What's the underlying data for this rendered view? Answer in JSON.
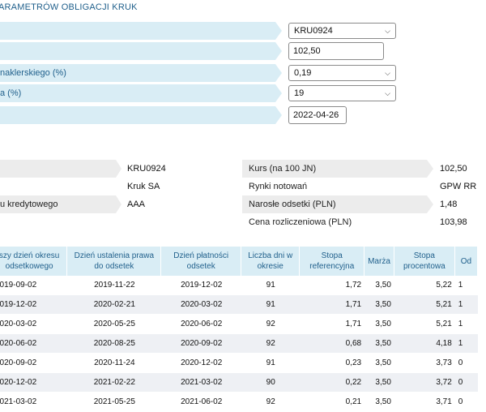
{
  "title": "ARAMETRÓW OBLIGACJI KRUK",
  "form": {
    "rows": [
      {
        "label": "",
        "type": "select",
        "value": "KRU0924"
      },
      {
        "label": "",
        "type": "input",
        "value": "102,50"
      },
      {
        "label": "naklerskiego (%)",
        "type": "select",
        "value": "0,19"
      },
      {
        "label": "a (%)",
        "type": "select",
        "value": "19"
      },
      {
        "label": "",
        "type": "date",
        "value": "2022-04-26"
      }
    ]
  },
  "info_left": [
    {
      "label": "",
      "value": "KRU0924"
    },
    {
      "label": "",
      "value": "Kruk SA"
    },
    {
      "label": "u kredytowego",
      "value": "AAA"
    }
  ],
  "info_right": [
    {
      "label": "Kurs (na 100 JN)",
      "value": "102,50"
    },
    {
      "label": "Rynki notowań",
      "value": "GPW RR"
    },
    {
      "label": "Narosłe odsetki (PLN)",
      "value": "1,48"
    },
    {
      "label": "Cena rozliczeniowa (PLN)",
      "value": "103,98"
    }
  ],
  "table": {
    "headers": [
      "szy dzień okresu odsetkowego",
      "Dzień ustalenia prawa do odsetek",
      "Dzień płatności odsetek",
      "Liczba dni w okresie",
      "Stopa referencyjna",
      "Marża",
      "Stopa procentowa",
      "Od"
    ],
    "rows": [
      [
        "2019-09-02",
        "2019-11-22",
        "2019-12-02",
        "91",
        "1,72",
        "3,50",
        "5,22",
        "1"
      ],
      [
        "2019-12-02",
        "2020-02-21",
        "2020-03-02",
        "91",
        "1,71",
        "3,50",
        "5,21",
        "1"
      ],
      [
        "2020-03-02",
        "2020-05-25",
        "2020-06-02",
        "92",
        "1,71",
        "3,50",
        "5,21",
        "1"
      ],
      [
        "2020-06-02",
        "2020-08-25",
        "2020-09-02",
        "92",
        "0,68",
        "3,50",
        "4,18",
        "1"
      ],
      [
        "2020-09-02",
        "2020-11-24",
        "2020-12-02",
        "91",
        "0,23",
        "3,50",
        "3,73",
        "0"
      ],
      [
        "2020-12-02",
        "2021-02-22",
        "2021-03-02",
        "90",
        "0,22",
        "3,50",
        "3,72",
        "0"
      ],
      [
        "2021-03-02",
        "2021-05-25",
        "2021-06-02",
        "92",
        "0,21",
        "3,50",
        "3,71",
        "0"
      ]
    ]
  }
}
